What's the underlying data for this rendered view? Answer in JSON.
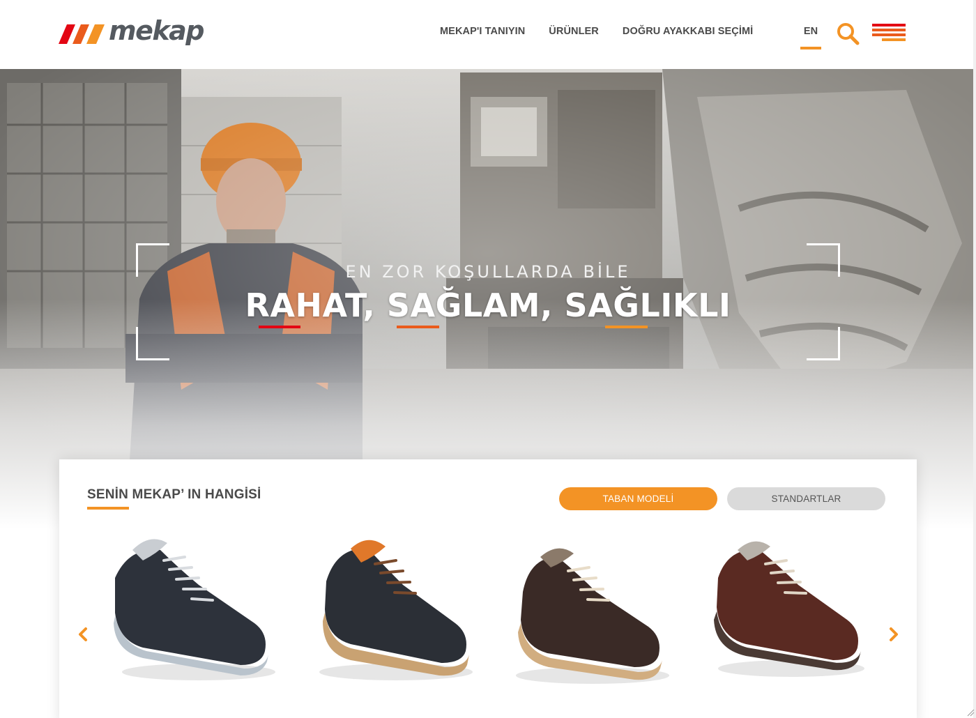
{
  "brand": {
    "name": "mekap",
    "colors": {
      "red": "#e30613",
      "orange_red": "#ea5b1c",
      "orange": "#f39325",
      "gray": "#555a60"
    }
  },
  "nav": {
    "items": [
      {
        "label": "MEKAP'I TANIYIN"
      },
      {
        "label": "ÜRÜNLER"
      },
      {
        "label": "DOĞRU AYAKKABI SEÇİMİ"
      }
    ],
    "language": "EN",
    "search_icon": "search-icon",
    "menu_icon": "hamburger-menu-icon"
  },
  "hero": {
    "subtitle": "EN ZOR KOŞULLARDA BİLE",
    "title": "RAHAT, SAĞLAM, SAĞLIKLI"
  },
  "products": {
    "title": "SENİN MEKAP’ IN HANGİSİ",
    "tabs": [
      {
        "label": "TABAN MODELİ",
        "active": true
      },
      {
        "label": "STANDARTLAR",
        "active": false
      }
    ],
    "items": [
      {
        "icon": "safety-shoe-black-grey-sole"
      },
      {
        "icon": "safety-shoe-black-tan-sole"
      },
      {
        "icon": "safety-shoe-brown-tan-sole"
      },
      {
        "icon": "safety-shoe-maroon-brown"
      }
    ],
    "prev_icon": "chevron-left-icon",
    "next_icon": "chevron-right-icon"
  }
}
